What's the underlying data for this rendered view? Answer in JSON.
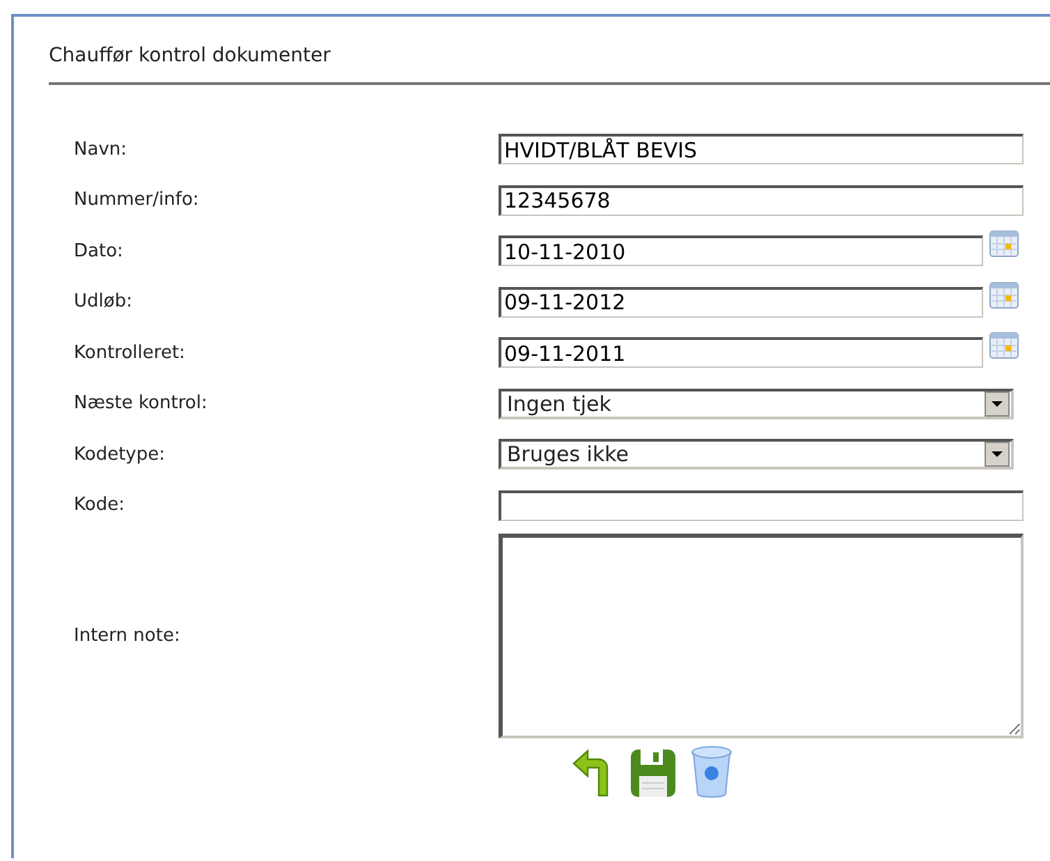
{
  "panel": {
    "title": "Chauffør kontrol dokumenter"
  },
  "fields": [
    {
      "label": "Navn:",
      "kind": "text",
      "value": "HVIDT/BLÅT BEVIS"
    },
    {
      "label": "Nummer/info:",
      "kind": "text",
      "value": "12345678"
    },
    {
      "label": "Dato:",
      "kind": "date",
      "value": "10-11-2010"
    },
    {
      "label": "Udløb:",
      "kind": "date",
      "value": "09-11-2012"
    },
    {
      "label": "Kontrolleret:",
      "kind": "date",
      "value": "09-11-2011"
    },
    {
      "label": "Næste kontrol:",
      "kind": "select",
      "value": "Ingen tjek"
    },
    {
      "label": "Kodetype:",
      "kind": "select",
      "value": "Bruges ikke"
    },
    {
      "label": "Kode:",
      "kind": "text"
    },
    {
      "label": "Intern note:",
      "kind": "textarea"
    }
  ],
  "actions": [
    {
      "kind": "back"
    },
    {
      "kind": "save"
    },
    {
      "kind": "delete"
    }
  ]
}
